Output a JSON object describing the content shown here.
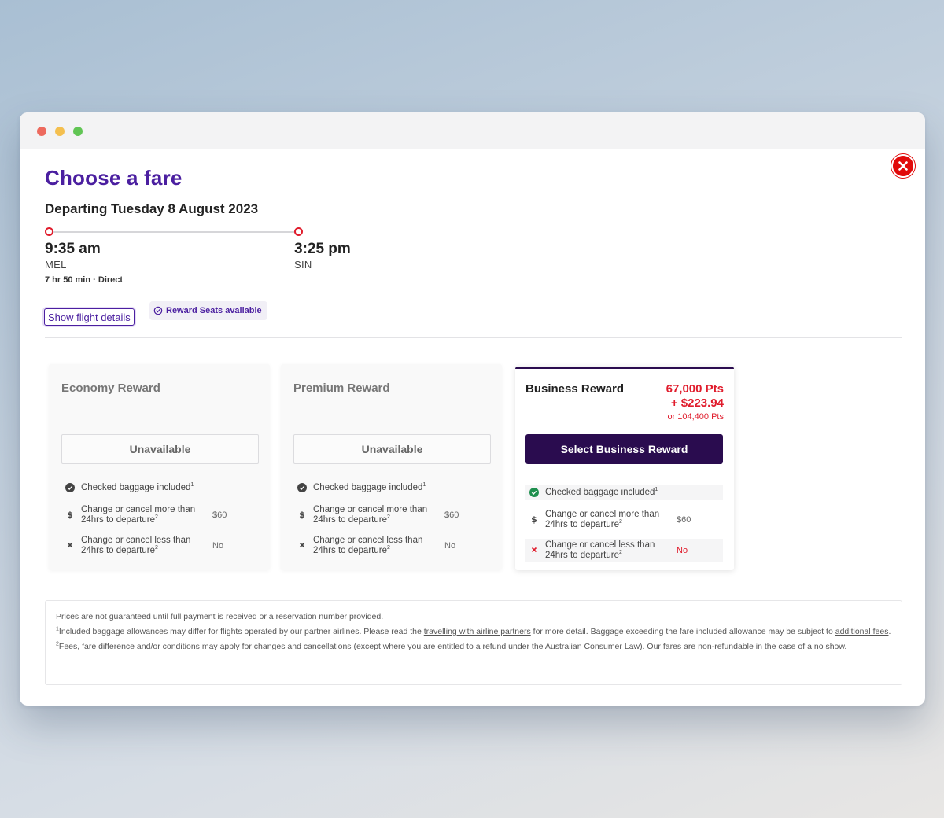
{
  "window": {
    "controls": [
      "close",
      "minimize",
      "zoom"
    ]
  },
  "modal": {
    "title": "Choose a fare",
    "departing": "Departing Tuesday 8 August 2023",
    "flight": {
      "depart_time": "9:35 am",
      "depart_code": "MEL",
      "arrive_time": "3:25 pm",
      "arrive_code": "SIN",
      "duration": "7 hr 50 min",
      "separator": "·",
      "stops": "Direct"
    },
    "show_details_label": "Show flight details",
    "reward_badge": "Reward Seats available"
  },
  "fares": {
    "economy": {
      "title": "Economy Reward",
      "status": "Unavailable",
      "features": [
        {
          "text": "Checked baggage included",
          "sup": "1",
          "value": ""
        },
        {
          "text": "Change or cancel more than 24hrs to departure",
          "sup": "2",
          "value": "$60"
        },
        {
          "text": "Change or cancel less than 24hrs to departure",
          "sup": "2",
          "value": "No"
        }
      ]
    },
    "premium": {
      "title": "Premium Reward",
      "status": "Unavailable",
      "features": [
        {
          "text": "Checked baggage included",
          "sup": "1",
          "value": ""
        },
        {
          "text": "Change or cancel more than 24hrs to departure",
          "sup": "2",
          "value": "$60"
        },
        {
          "text": "Change or cancel less than 24hrs to departure",
          "sup": "2",
          "value": "No"
        }
      ]
    },
    "business": {
      "title": "Business Reward",
      "points": "67,000 Pts",
      "cash": "+ $223.94",
      "alt": "or 104,400 Pts",
      "select_label": "Select Business Reward",
      "features": [
        {
          "text": "Checked baggage included",
          "sup": "1",
          "value": ""
        },
        {
          "text": "Change or cancel more than 24hrs to departure",
          "sup": "2",
          "value": "$60"
        },
        {
          "text": "Change or cancel less than 24hrs to departure",
          "sup": "2",
          "value": "No"
        }
      ]
    }
  },
  "colors": {
    "brand_purple": "#4b1fa0",
    "dark_purple": "#2a0c4f",
    "red": "#e01c2c",
    "green": "#1e8f4e"
  },
  "fineprint": {
    "line1": "Prices are not guaranteed until full payment is received or a reservation number provided.",
    "line2_sup": "1",
    "line2_pre": "Included baggage allowances may differ for flights operated by our partner airlines. Please read the ",
    "line2_link1": "travelling with airline partners",
    "line2_mid": " for more detail. Baggage exceeding the fare included allowance may be subject to ",
    "line2_link2": "additional fees",
    "line2_post": ".",
    "line3_sup": "2",
    "line3_link": "Fees, fare difference and/or conditions may apply",
    "line3_post": " for changes and cancellations (except where you are entitled to a refund under the Australian Consumer Law). Our fares are non-refundable in the case of a no show."
  }
}
